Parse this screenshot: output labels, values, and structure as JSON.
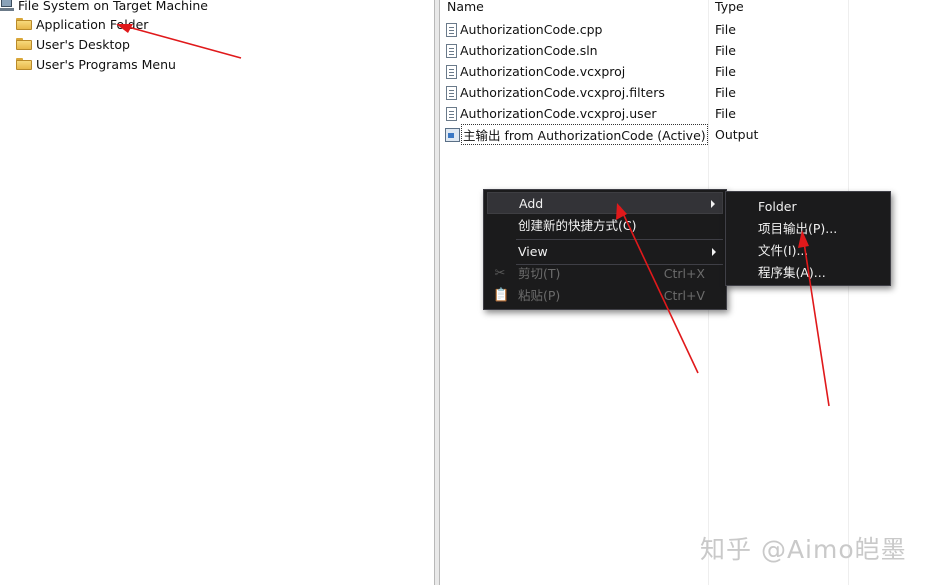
{
  "tree": {
    "root_label": "File System on Target Machine",
    "items": [
      {
        "label": "Application Folder",
        "icon": "folder-icon"
      },
      {
        "label": "User's Desktop",
        "icon": "folder-icon"
      },
      {
        "label": "User's Programs Menu",
        "icon": "folder-icon"
      }
    ]
  },
  "list": {
    "columns": {
      "name": "Name",
      "type": "Type"
    },
    "rows": [
      {
        "name": "AuthorizationCode.cpp",
        "type": "File",
        "icon": "document-icon"
      },
      {
        "name": "AuthorizationCode.sln",
        "type": "File",
        "icon": "document-icon"
      },
      {
        "name": "AuthorizationCode.vcxproj",
        "type": "File",
        "icon": "document-icon"
      },
      {
        "name": "AuthorizationCode.vcxproj.filters",
        "type": "File",
        "icon": "document-icon"
      },
      {
        "name": "AuthorizationCode.vcxproj.user",
        "type": "File",
        "icon": "document-icon"
      },
      {
        "name": "主输出 from AuthorizationCode (Active)",
        "type": "Output",
        "icon": "project-output-icon"
      }
    ]
  },
  "context_menu": {
    "add": "Add",
    "create_shortcut": "创建新的快捷方式(C)",
    "view": "View",
    "cut": "剪切(T)",
    "cut_shortcut": "Ctrl+X",
    "paste": "粘贴(P)",
    "paste_shortcut": "Ctrl+V"
  },
  "submenu": {
    "folder": "Folder",
    "project_output": "项目输出(P)...",
    "file": "文件(I)...",
    "assembly": "程序集(A)..."
  },
  "watermark": "知乎 @Aimo皑墨",
  "colors": {
    "menu_background": "#1b1b1c",
    "menu_text": "#f1f1f1",
    "annotation_arrow": "#e0191b"
  }
}
